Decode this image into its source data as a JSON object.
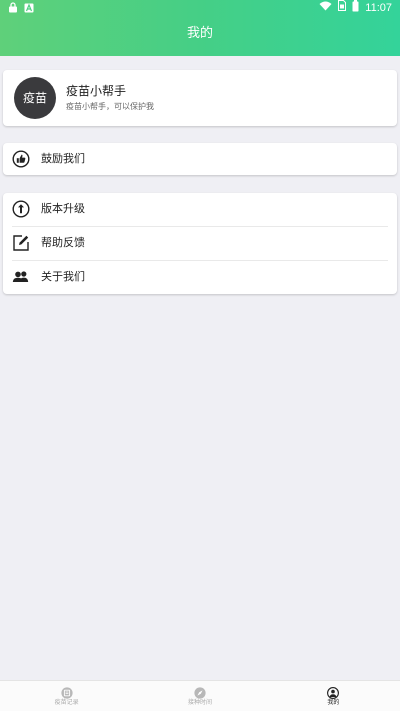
{
  "status_bar": {
    "time": "11:07",
    "left_icons": [
      "lock-icon",
      "a-notification-icon"
    ],
    "right_icons": [
      "wifi-icon",
      "sim-card-icon",
      "battery-icon"
    ]
  },
  "header": {
    "title": "我的",
    "gradient_colors": [
      "#5fd07a",
      "#34d39a"
    ]
  },
  "profile": {
    "avatar_text": "疫苗",
    "avatar_color": "#3a3a3d",
    "name": "疫苗小帮手",
    "description": "疫苗小帮手，可以保护我"
  },
  "encourage": {
    "label": "鼓励我们",
    "icon": "thumbs-up-icon"
  },
  "menu": {
    "items": [
      {
        "label": "版本升级",
        "icon": "upgrade-arrow-icon"
      },
      {
        "label": "帮助反馈",
        "icon": "edit-icon"
      },
      {
        "label": "关于我们",
        "icon": "people-icon"
      }
    ]
  },
  "tabbar": {
    "items": [
      {
        "label": "疫苗记录",
        "icon": "record-icon",
        "active": false
      },
      {
        "label": "接种时间",
        "icon": "compass-icon",
        "active": false
      },
      {
        "label": "我的",
        "icon": "person-icon",
        "active": true
      }
    ]
  }
}
